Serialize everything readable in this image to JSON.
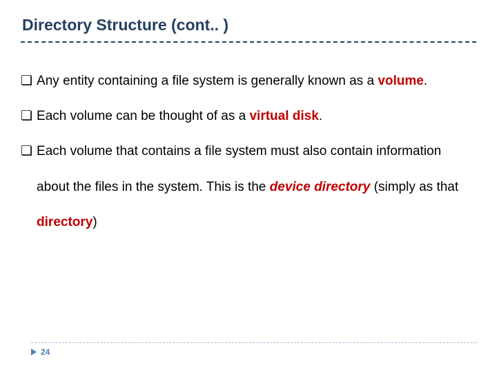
{
  "title": "Directory Structure (cont.. )",
  "bullets": {
    "b1": {
      "pre": "Any entity containing a file system is generally known as a ",
      "em": "volume",
      "post": "."
    },
    "b2": {
      "pre": "Each volume can be thought of as a ",
      "em": "virtual disk",
      "post": "."
    },
    "b3": {
      "pre": "Each volume that contains a file system must also contain information about the files in the system. This is the ",
      "em": "device directory",
      "mid": " (simply as that ",
      "em2": "directory",
      "post": ")"
    }
  },
  "page_number": "24",
  "bullet_glyph": "❏"
}
